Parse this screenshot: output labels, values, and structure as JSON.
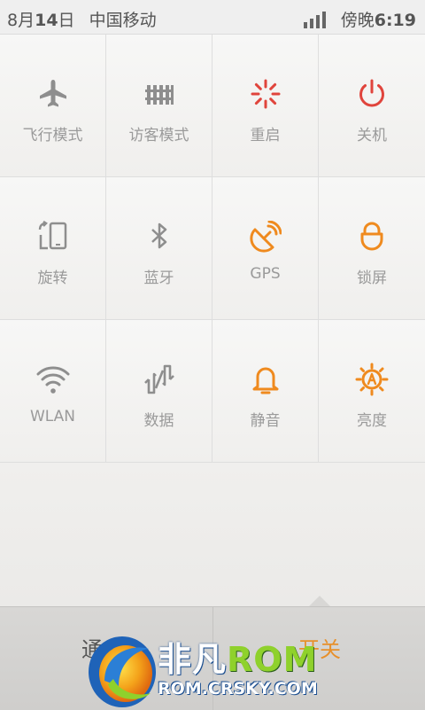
{
  "status_bar": {
    "date_month": "8月",
    "date_day": "14",
    "date_suffix": "日",
    "carrier": "中国移动",
    "time_prefix": "傍晚",
    "time": "6:19"
  },
  "toggles": [
    {
      "label": "飞行模式",
      "icon": "airplane-icon",
      "color": "#8e8e8e"
    },
    {
      "label": "访客模式",
      "icon": "guest-mode-icon",
      "color": "#8e8e8e"
    },
    {
      "label": "重启",
      "icon": "reboot-icon",
      "color": "#e0443c"
    },
    {
      "label": "关机",
      "icon": "power-icon",
      "color": "#e0443c"
    },
    {
      "label": "旋转",
      "icon": "rotate-icon",
      "color": "#8e8e8e"
    },
    {
      "label": "蓝牙",
      "icon": "bluetooth-icon",
      "color": "#8e8e8e"
    },
    {
      "label": "GPS",
      "icon": "gps-icon",
      "color": "#ef8a1e"
    },
    {
      "label": "锁屏",
      "icon": "lock-icon",
      "color": "#ef8a1e"
    },
    {
      "label": "WLAN",
      "icon": "wifi-icon",
      "color": "#8e8e8e"
    },
    {
      "label": "数据",
      "icon": "data-icon",
      "color": "#8e8e8e"
    },
    {
      "label": "静音",
      "icon": "bell-icon",
      "color": "#ef8a1e"
    },
    {
      "label": "亮度",
      "icon": "brightness-icon",
      "color": "#ef8a1e"
    }
  ],
  "tabs": {
    "left": "通",
    "right": "开关",
    "active": "right"
  },
  "watermark": {
    "name_cn": "非凡",
    "name_rom": "ROM",
    "site": "ROM.CRSKY.COM"
  }
}
